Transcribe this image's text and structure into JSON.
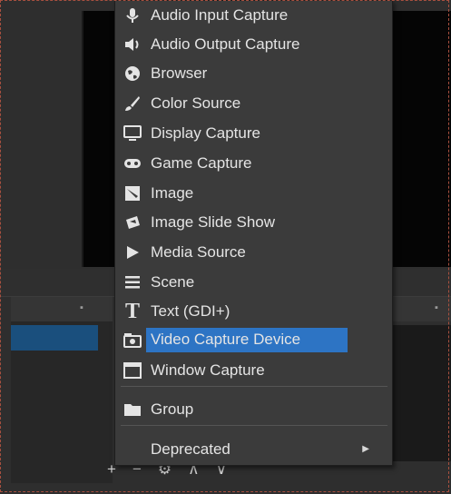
{
  "menu": {
    "items": [
      {
        "label": "Audio Input Capture",
        "icon": "microphone-icon"
      },
      {
        "label": "Audio Output Capture",
        "icon": "speaker-icon"
      },
      {
        "label": "Browser",
        "icon": "globe-icon"
      },
      {
        "label": "Color Source",
        "icon": "paintbrush-icon"
      },
      {
        "label": "Display Capture",
        "icon": "monitor-icon"
      },
      {
        "label": "Game Capture",
        "icon": "gamepad-icon"
      },
      {
        "label": "Image",
        "icon": "image-icon"
      },
      {
        "label": "Image Slide Show",
        "icon": "slideshow-icon"
      },
      {
        "label": "Media Source",
        "icon": "play-icon"
      },
      {
        "label": "Scene",
        "icon": "list-icon"
      },
      {
        "label": "Text (GDI+)",
        "icon": "text-icon"
      },
      {
        "label": "Video Capture Device",
        "icon": "camera-icon",
        "selected": true
      },
      {
        "label": "Window Capture",
        "icon": "window-icon"
      },
      {
        "label": "Group",
        "icon": "folder-icon"
      },
      {
        "label": "Deprecated",
        "icon": "submenu-arrow-icon"
      }
    ]
  },
  "toolbar": {
    "add": "+",
    "remove": "−",
    "settings": "⚙",
    "up": "∧",
    "down": "∨"
  },
  "colors": {
    "selection": "#2d74c4",
    "menu_bg": "#3b3b3b",
    "preview_bg": "#050505"
  }
}
